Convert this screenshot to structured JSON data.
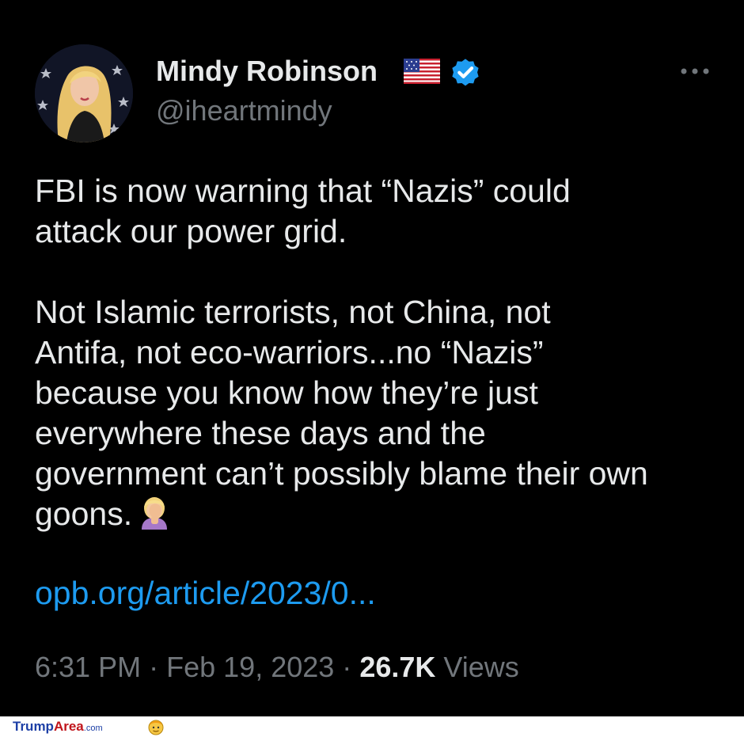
{
  "tweet": {
    "display_name": "Mindy Robinson",
    "handle": "@iheartmindy",
    "text_lines": [
      "FBI is now warning that “Nazis” could",
      "attack our power grid.",
      "Not Islamic terrorists, not China, not",
      "Antifa, not eco-warriors...no “Nazis”",
      "because you know how they’re just",
      "everywhere these days and the",
      "government can’t possibly blame their own",
      "goons."
    ],
    "link": "opb.org/article/2023/0...",
    "time": "6:31 PM",
    "date": "Feb 19, 2023",
    "views_count": "26.7K",
    "views_label": "Views",
    "separator": "·"
  },
  "icons": {
    "flag": "us-flag-icon",
    "verified": "verified-badge-icon",
    "more": "more-options-icon",
    "emoji": "face-palm-emoji"
  },
  "colors": {
    "background": "#000000",
    "primary_text": "#e7e9ea",
    "secondary_text": "#71767b",
    "link": "#1d9bf0",
    "verified": "#1d9bf0"
  },
  "footer": {
    "logo_trump": "Trump",
    "logo_area": "Area",
    "logo_suffix": ".com"
  }
}
